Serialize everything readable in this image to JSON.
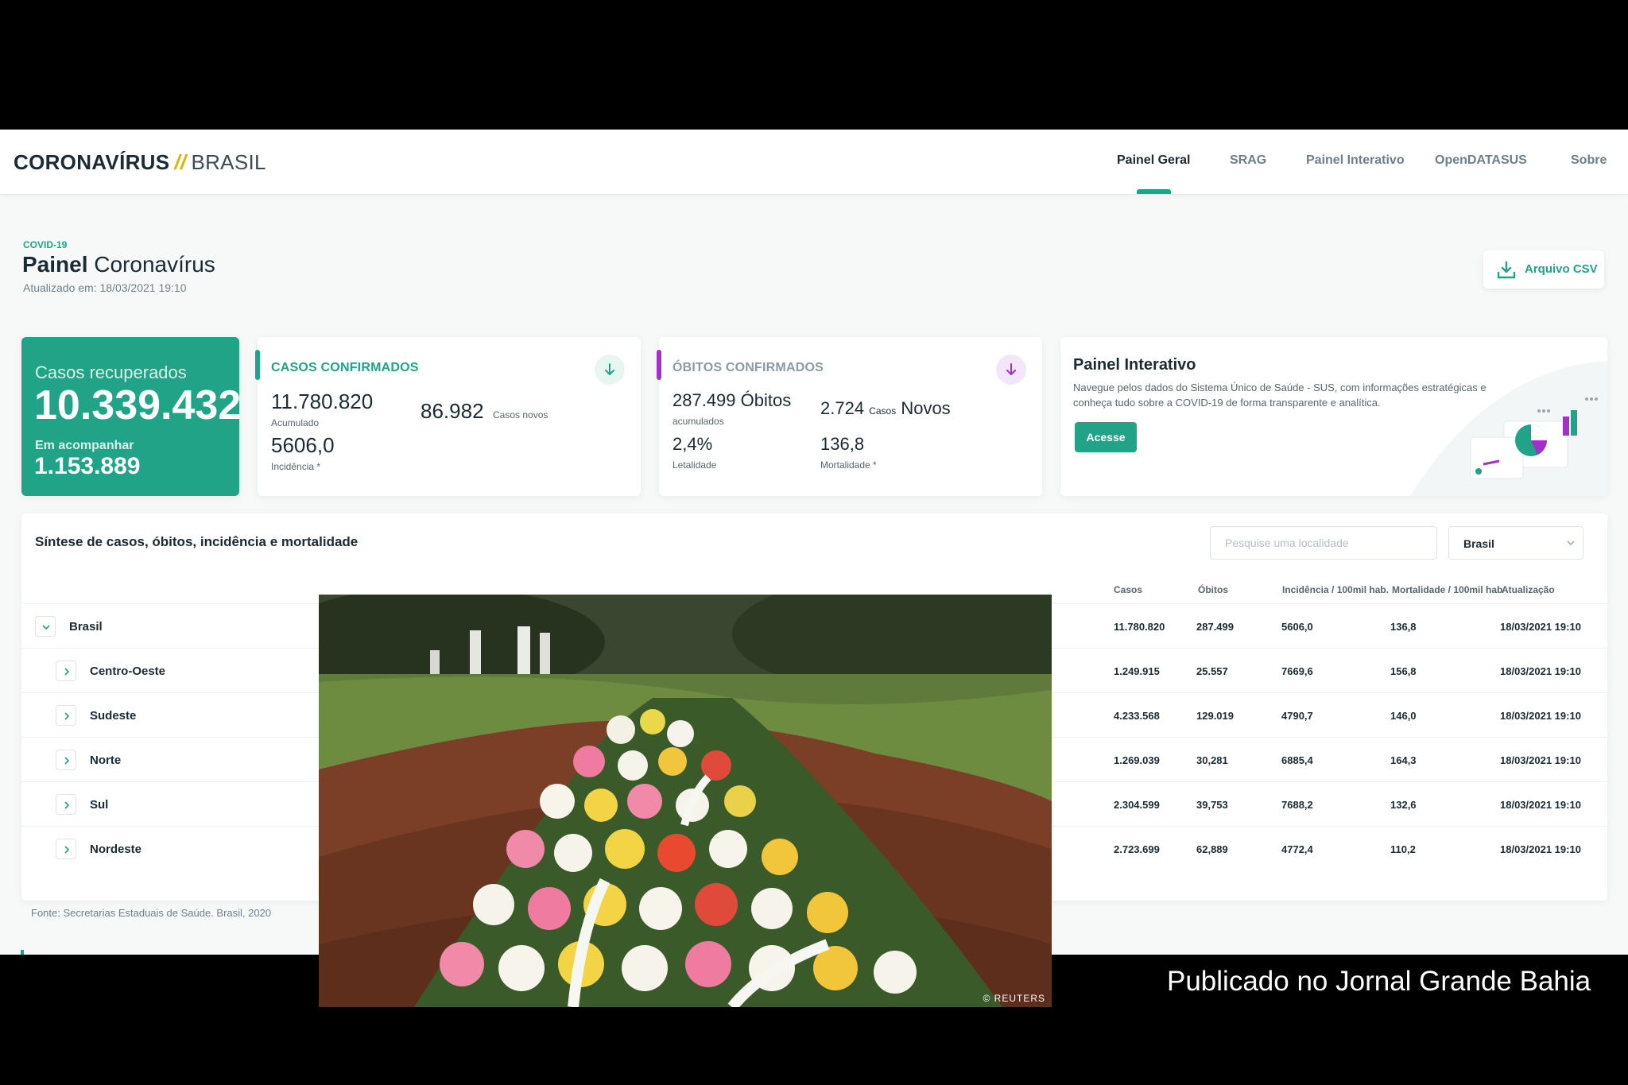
{
  "header": {
    "logo_main": "CORONAVÍRUS",
    "logo_sep": "//",
    "logo_country": "BRASIL",
    "nav": [
      "Painel Geral",
      "SRAG",
      "Painel Interativo",
      "OpenDATASUS",
      "Sobre"
    ],
    "active_nav": "Painel Geral"
  },
  "title_block": {
    "tag": "COVID-19",
    "title_bold": "Painel",
    "title_rest": " Coronavírus",
    "updated": "Atualizado em: 18/03/2021 19:10",
    "csv_button": "Arquivo CSV"
  },
  "recovered": {
    "label": "Casos recuperados",
    "value": "10.339.432",
    "follow_label": "Em acompanhar",
    "follow_value": "1.153.889"
  },
  "confirmed": {
    "header": "CASOS CONFIRMADOS",
    "accumulated": "11.780.820",
    "accumulated_label": "Acumulado",
    "new_cases": "86.982",
    "new_label": "Casos novos",
    "incidence": "5606,0",
    "incidence_label": "Incidência *"
  },
  "deaths": {
    "header": "ÓBITOS CONFIRMADOS",
    "accumulated": "287.499",
    "accumulated_word": " Óbitos",
    "accumulated_label": "acumulados",
    "new_value": "2.724",
    "new_small": "Casos",
    "new_word": "Novos",
    "lethality": "2,4%",
    "lethality_label": "Letalidade",
    "mortality": "136,8",
    "mortality_label": "Mortalidade *"
  },
  "painel_interativo": {
    "title": "Painel Interativo",
    "description": "Navegue pelos dados do Sistema Único de Saúde - SUS, com informações estratégicas e conheça tudo sobre a COVID-19 de forma transparente e analítica.",
    "button": "Acesse"
  },
  "table": {
    "title": "Síntese de casos, óbitos, incidência e mortalidade",
    "search_placeholder": "Pesquise uma localidade",
    "select_value": "Brasil",
    "columns": [
      "Casos",
      "Óbitos",
      "Incidência / 100mil hab.",
      "Mortalidade / 100mil hab",
      "Atualização"
    ],
    "rows": [
      {
        "name": "Brasil",
        "casos": "11.780.820",
        "obitos": "287.499",
        "incidencia": "5606,0",
        "mortalidade": "136,8",
        "atualizacao": "18/03/2021 19:10"
      },
      {
        "name": "Centro-Oeste",
        "casos": "1.249.915",
        "obitos": "25.557",
        "incidencia": "7669,6",
        "mortalidade": "156,8",
        "atualizacao": "18/03/2021 19:10"
      },
      {
        "name": "Sudeste",
        "casos": "4.233.568",
        "obitos": "129.019",
        "incidencia": "4790,7",
        "mortalidade": "146,0",
        "atualizacao": "18/03/2021 19:10"
      },
      {
        "name": "Norte",
        "casos": "1.269.039",
        "obitos": "30,281",
        "incidencia": "6885,4",
        "mortalidade": "164,3",
        "atualizacao": "18/03/2021 19:10"
      },
      {
        "name": "Sul",
        "casos": "2.304.599",
        "obitos": "39,753",
        "incidencia": "7688,2",
        "mortalidade": "132,6",
        "atualizacao": "18/03/2021 19:10"
      },
      {
        "name": "Nordeste",
        "casos": "2.723.699",
        "obitos": "62,889",
        "incidencia": "4772,4",
        "mortalidade": "110,2",
        "atualizacao": "18/03/2021 19:10"
      }
    ],
    "source": "Fonte: Secretarias Estaduais de Saúde. Brasil, 2020"
  },
  "photo": {
    "credit": "© REUTERS"
  },
  "caption": "Publicado no Jornal Grande Bahia",
  "colors": {
    "accent": "#20a386",
    "deaths_accent": "#a131c9",
    "text": "#1b2a33"
  }
}
